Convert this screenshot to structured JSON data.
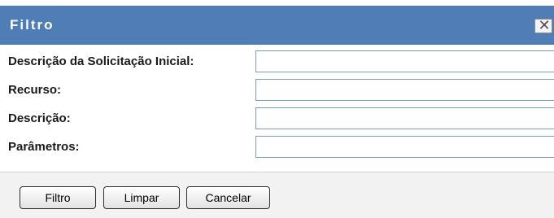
{
  "dialog": {
    "title": "Filtro",
    "close_icon": "close-icon"
  },
  "form": {
    "fields": [
      {
        "label": "Descrição da Solicitação Inicial:",
        "value": "",
        "placeholder": ""
      },
      {
        "label": "Recurso:",
        "value": "",
        "placeholder": ""
      },
      {
        "label": "Descrição:",
        "value": "",
        "placeholder": ""
      },
      {
        "label": "Parâmetros:",
        "value": "",
        "placeholder": ""
      }
    ]
  },
  "footer": {
    "filter_label": "Filtro",
    "clear_label": "Limpar",
    "cancel_label": "Cancelar"
  },
  "colors": {
    "titlebar": "#4f7eb6",
    "field_border": "#7a9cc4"
  }
}
